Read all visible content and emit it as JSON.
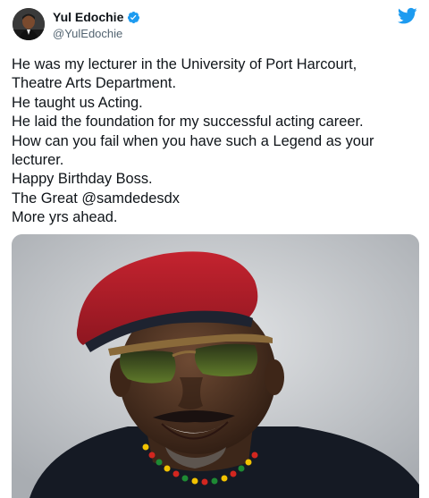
{
  "author": {
    "display_name": "Yul Edochie",
    "handle": "@YulEdochie",
    "verified": true,
    "avatar_icon": "profile-photo"
  },
  "brand": {
    "icon": "twitter-bird-icon",
    "color": "#1d9bf0"
  },
  "tweet": {
    "lines": [
      "He was my lecturer in the University of Port Harcourt,",
      "Theatre Arts Department.",
      "He taught us Acting.",
      "He laid the foundation for my successful acting career.",
      "How can you fail when you have such a Legend as your",
      "lecturer.",
      "Happy Birthday Boss.",
      "The Great @samdedesdx",
      "More yrs ahead."
    ]
  },
  "media": {
    "type": "photo",
    "subject": "man in red beret and tinted sunglasses smiling"
  }
}
